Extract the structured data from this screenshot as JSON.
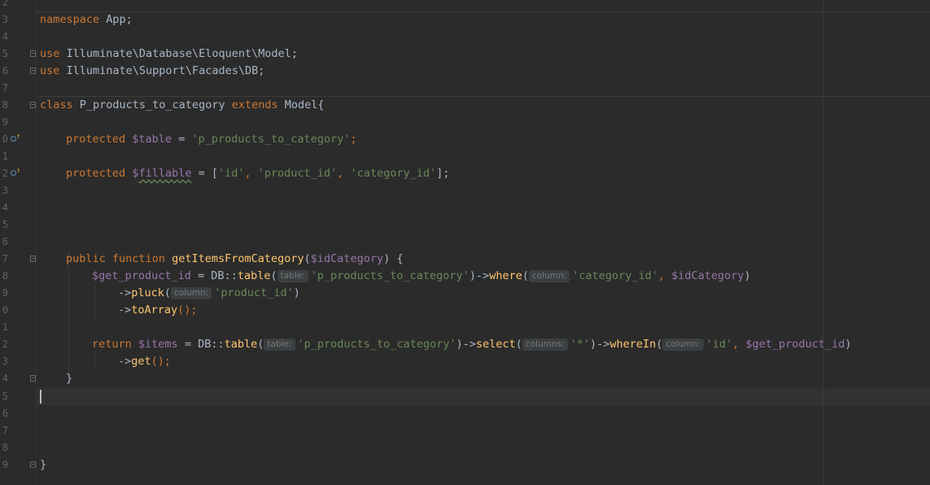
{
  "gutter": {
    "lines": [
      {
        "num": "2",
        "fold": false,
        "override": false
      },
      {
        "num": "3",
        "fold": false,
        "override": false
      },
      {
        "num": "4",
        "fold": false,
        "override": false
      },
      {
        "num": "5",
        "fold": true,
        "override": false
      },
      {
        "num": "6",
        "fold": true,
        "override": false
      },
      {
        "num": "7",
        "fold": false,
        "override": false
      },
      {
        "num": "8",
        "fold": true,
        "override": false
      },
      {
        "num": "9",
        "fold": false,
        "override": false
      },
      {
        "num": "0",
        "fold": false,
        "override": true
      },
      {
        "num": "1",
        "fold": false,
        "override": false
      },
      {
        "num": "2",
        "fold": false,
        "override": true
      },
      {
        "num": "3",
        "fold": false,
        "override": false
      },
      {
        "num": "4",
        "fold": false,
        "override": false
      },
      {
        "num": "5",
        "fold": false,
        "override": false
      },
      {
        "num": "6",
        "fold": false,
        "override": false
      },
      {
        "num": "7",
        "fold": true,
        "override": false
      },
      {
        "num": "8",
        "fold": false,
        "override": false
      },
      {
        "num": "9",
        "fold": false,
        "override": false
      },
      {
        "num": "0",
        "fold": false,
        "override": false
      },
      {
        "num": "1",
        "fold": false,
        "override": false
      },
      {
        "num": "2",
        "fold": false,
        "override": false
      },
      {
        "num": "3",
        "fold": false,
        "override": false
      },
      {
        "num": "4",
        "fold": true,
        "override": false
      },
      {
        "num": "5",
        "fold": false,
        "override": false
      },
      {
        "num": "6",
        "fold": false,
        "override": false
      },
      {
        "num": "7",
        "fold": false,
        "override": false
      },
      {
        "num": "8",
        "fold": false,
        "override": false
      },
      {
        "num": "9",
        "fold": true,
        "override": false
      }
    ]
  },
  "code": {
    "l3": {
      "kw": "namespace",
      "rest": " App;"
    },
    "l5": {
      "kw": "use",
      "rest": " Illuminate\\Database\\Eloquent\\Model;"
    },
    "l6": {
      "kw": "use",
      "rest": " Illuminate\\Support\\Facades\\DB;"
    },
    "l8": {
      "kw1": "class",
      "name": " P_products_to_category ",
      "kw2": "extends",
      "rest": " Model{"
    },
    "l10": {
      "kw": "protected",
      "var": "$table",
      "eq": " = ",
      "str": "'p_products_to_category'",
      "end": ";"
    },
    "l12": {
      "kw": "protected",
      "var_a": "$",
      "var_b": "fillable",
      "eq": " = [",
      "s1": "'id'",
      "c1": ", ",
      "s2": "'product_id'",
      "c2": ", ",
      "s3": "'category_id'",
      "end": "];"
    },
    "l17": {
      "kw1": "public",
      "kw2": "function",
      "fn": "getItemsFromCategory",
      "p1": "(",
      "var": "$idCategory",
      "p2": ") {"
    },
    "l18": {
      "var": "$get_product_id",
      "a": " = DB::",
      "fn1": "table",
      "b": "(",
      "hint1": "table:",
      "s1": "'p_products_to_category'",
      "c": ")->",
      "fn2": "where",
      "d": "(",
      "hint2": "column:",
      "s2": "'category_id'",
      "e": ", ",
      "var2": "$idCategory",
      "f": ")"
    },
    "l19": {
      "a": "->",
      "fn": "pluck",
      "b": "(",
      "hint": "column:",
      "s": "'product_id'",
      "c": ")"
    },
    "l20": {
      "a": "->",
      "fn": "toArray",
      "b": "();"
    },
    "l22": {
      "kw": "return",
      "var": "$items",
      "a": " = DB::",
      "fn1": "table",
      "b": "(",
      "hint1": "table:",
      "s1": "'p_products_to_category'",
      "c": ")->",
      "fn2": "select",
      "d": "(",
      "hint2": "columns:",
      "s2": "'*'",
      "e": ")->",
      "fn3": "whereIn",
      "f": "(",
      "hint3": "column:",
      "s3": "'id'",
      "g": ", ",
      "var2": "$get_product_id",
      "h": ")"
    },
    "l23": {
      "a": "->",
      "fn": "get",
      "b": "();"
    },
    "l24": {
      "brace": "}"
    },
    "l29": {
      "brace": "}"
    }
  },
  "colors": {
    "background": "#2b2b2b",
    "keyword": "#cc7832",
    "variable": "#9876aa",
    "string": "#6a8759",
    "function": "#ffc66d",
    "text": "#a9b7c6"
  }
}
